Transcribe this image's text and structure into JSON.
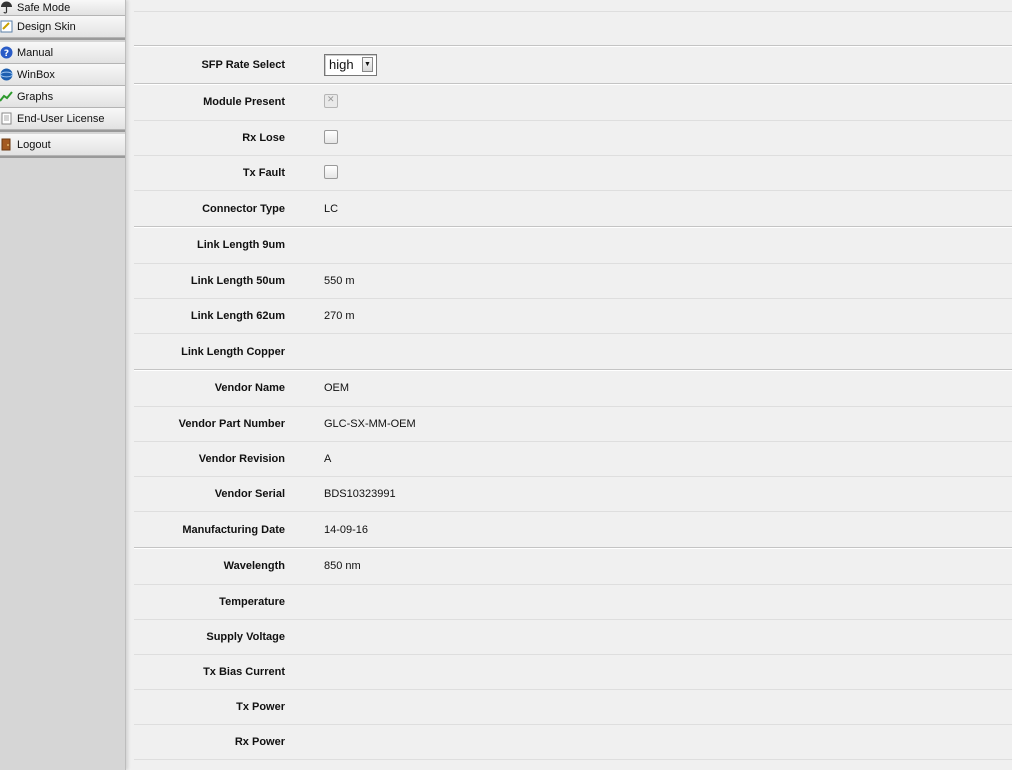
{
  "sidebar": {
    "groups": [
      [
        {
          "label": "Safe Mode",
          "icon": "umbrella-icon"
        },
        {
          "label": "Design Skin",
          "icon": "design-skin-icon"
        }
      ],
      [
        {
          "label": "Manual",
          "icon": "help-icon"
        },
        {
          "label": "WinBox",
          "icon": "winbox-icon"
        },
        {
          "label": "Graphs",
          "icon": "graphs-icon"
        },
        {
          "label": "End-User License",
          "icon": "document-icon"
        }
      ],
      [
        {
          "label": "Logout",
          "icon": "logout-icon"
        }
      ]
    ]
  },
  "form": {
    "rate_select": {
      "label": "SFP Rate Select",
      "value": "high"
    },
    "module_present": {
      "label": "Module Present"
    },
    "rx_lose": {
      "label": "Rx Lose"
    },
    "tx_fault": {
      "label": "Tx Fault"
    },
    "connector_type": {
      "label": "Connector Type",
      "value": "LC"
    },
    "link_9um": {
      "label": "Link Length 9um",
      "value": ""
    },
    "link_50um": {
      "label": "Link Length 50um",
      "value": "550 m"
    },
    "link_62um": {
      "label": "Link Length 62um",
      "value": "270 m"
    },
    "link_copper": {
      "label": "Link Length Copper",
      "value": ""
    },
    "vendor_name": {
      "label": "Vendor Name",
      "value": "OEM"
    },
    "vendor_part": {
      "label": "Vendor Part Number",
      "value": "GLC-SX-MM-OEM"
    },
    "vendor_rev": {
      "label": "Vendor Revision",
      "value": "A"
    },
    "vendor_serial": {
      "label": "Vendor Serial",
      "value": "BDS10323991"
    },
    "mfg_date": {
      "label": "Manufacturing Date",
      "value": "14-09-16"
    },
    "wavelength": {
      "label": "Wavelength",
      "value": "850 nm"
    },
    "temperature": {
      "label": "Temperature",
      "value": ""
    },
    "supply_voltage": {
      "label": "Supply Voltage",
      "value": ""
    },
    "tx_bias": {
      "label": "Tx Bias Current",
      "value": ""
    },
    "tx_power": {
      "label": "Tx Power",
      "value": ""
    },
    "rx_power": {
      "label": "Rx Power",
      "value": ""
    }
  }
}
